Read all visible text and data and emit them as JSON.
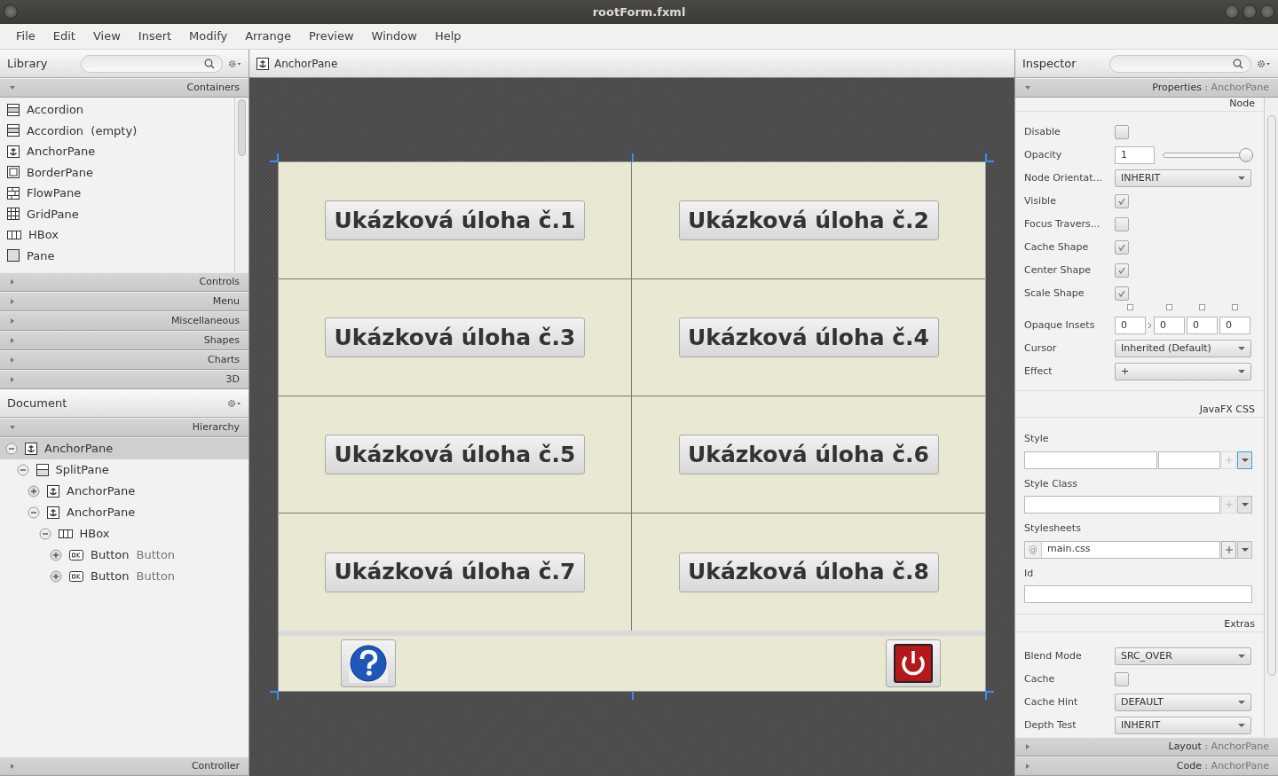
{
  "window": {
    "title": "rootForm.fxml"
  },
  "menu": [
    "File",
    "Edit",
    "View",
    "Insert",
    "Modify",
    "Arrange",
    "Preview",
    "Window",
    "Help"
  ],
  "library": {
    "title": "Library",
    "sections": [
      {
        "label": "Containers",
        "expanded": true,
        "items": [
          {
            "kind": "accordion",
            "label": "Accordion"
          },
          {
            "kind": "accordion",
            "label": "Accordion  (empty)"
          },
          {
            "kind": "anchor",
            "label": "AnchorPane"
          },
          {
            "kind": "border",
            "label": "BorderPane"
          },
          {
            "kind": "flow",
            "label": "FlowPane"
          },
          {
            "kind": "grid",
            "label": "GridPane"
          },
          {
            "kind": "hbox",
            "label": "HBox"
          },
          {
            "kind": "pane",
            "label": "Pane"
          }
        ]
      },
      {
        "label": "Controls",
        "expanded": false
      },
      {
        "label": "Menu",
        "expanded": false
      },
      {
        "label": "Miscellaneous",
        "expanded": false
      },
      {
        "label": "Shapes",
        "expanded": false
      },
      {
        "label": "Charts",
        "expanded": false
      },
      {
        "label": "3D",
        "expanded": false
      }
    ]
  },
  "document": {
    "title": "Document",
    "hierarchy_label": "Hierarchy",
    "tree": [
      {
        "kind": "anchor",
        "label": "AnchorPane",
        "expanded": true,
        "selected": true,
        "children": [
          {
            "kind": "split",
            "label": "SplitPane",
            "expanded": true,
            "selected": false,
            "children": [
              {
                "kind": "anchor",
                "label": "AnchorPane",
                "expanded": false,
                "selected": false
              },
              {
                "kind": "anchor",
                "label": "AnchorPane",
                "expanded": true,
                "selected": false,
                "children": [
                  {
                    "kind": "hbox",
                    "label": "HBox",
                    "expanded": true,
                    "selected": false,
                    "children": [
                      {
                        "kind": "button",
                        "label": "Button",
                        "detail": "Button",
                        "expanded": false,
                        "selected": false
                      },
                      {
                        "kind": "button",
                        "label": "Button",
                        "detail": "Button",
                        "expanded": false,
                        "selected": false
                      }
                    ]
                  }
                ]
              }
            ]
          }
        ]
      }
    ],
    "controller_label": "Controller"
  },
  "editor": {
    "breadcrumb": "AnchorPane",
    "task_buttons": [
      "Ukázková úloha č.1",
      "Ukázková úloha č.2",
      "Ukázková úloha č.3",
      "Ukázková úloha č.4",
      "Ukázková úloha č.5",
      "Ukázková úloha č.6",
      "Ukázková úloha č.7",
      "Ukázková úloha č.8"
    ],
    "footer_buttons": [
      {
        "kind": "help"
      },
      {
        "kind": "power"
      }
    ]
  },
  "inspector": {
    "title": "Inspector",
    "properties_label": "Properties",
    "separator": ":",
    "properties_target": "AnchorPane",
    "node_section": "Node",
    "node_rows": [
      {
        "kind": "checkbox",
        "label": "Disable",
        "checked": false
      },
      {
        "kind": "slider",
        "label": "Opacity",
        "value": "1",
        "level": 1
      },
      {
        "kind": "select",
        "label": "Node Orientat...",
        "value": "INHERIT"
      },
      {
        "kind": "checkbox",
        "label": "Visible",
        "checked": true
      },
      {
        "kind": "checkbox",
        "label": "Focus Travers...",
        "checked": false
      },
      {
        "kind": "checkbox",
        "label": "Cache Shape",
        "checked": true
      },
      {
        "kind": "checkbox",
        "label": "Center Shape",
        "checked": true
      },
      {
        "kind": "checkbox",
        "label": "Scale Shape",
        "checked": true
      },
      {
        "kind": "insets",
        "label": "Opaque Insets",
        "values": [
          "0",
          "0",
          "0",
          "0"
        ]
      },
      {
        "kind": "select",
        "label": "Cursor",
        "value": "Inherited (Default)"
      },
      {
        "kind": "select",
        "label": "Effect",
        "value": "+"
      }
    ],
    "css_section": "JavaFX CSS",
    "css_fields": [
      {
        "kind": "pair",
        "label": "Style"
      },
      {
        "kind": "list",
        "label": "Style Class"
      },
      {
        "kind": "list",
        "label": "Stylesheets",
        "prefix": "@",
        "value": "main.css"
      },
      {
        "kind": "text",
        "label": "Id"
      }
    ],
    "extras_section": "Extras",
    "extras_rows": [
      {
        "kind": "select",
        "label": "Blend Mode",
        "value": "SRC_OVER"
      },
      {
        "kind": "checkbox",
        "label": "Cache",
        "checked": false
      },
      {
        "kind": "select",
        "label": "Cache Hint",
        "value": "DEFAULT"
      },
      {
        "kind": "select",
        "label": "Depth Test",
        "value": "INHERIT"
      }
    ],
    "collapsed_sections": [
      {
        "label": "Layout",
        "separator": ":",
        "target": "AnchorPane"
      },
      {
        "label": "Code",
        "separator": ":",
        "target": "AnchorPane"
      }
    ]
  }
}
